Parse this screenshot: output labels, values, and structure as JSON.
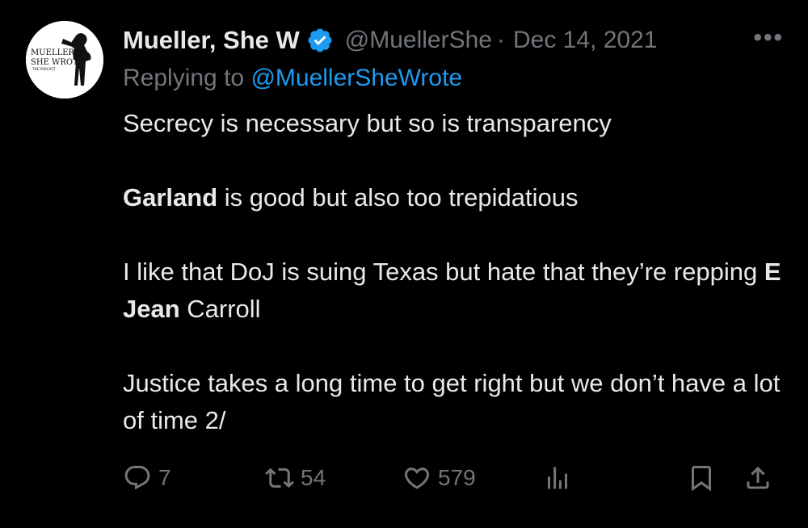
{
  "tweet": {
    "author_name": "Mueller, She W",
    "handle": "@MuellerShe",
    "separator": "·",
    "date": "Dec 14, 2021",
    "more": "•••",
    "replying_prefix": "Replying to ",
    "replying_to": "@MuellerSheWrote",
    "avatar_text": [
      "MUELLER,",
      "SHE WROTE",
      "THE PODCAST"
    ],
    "body": {
      "line1": "Secrecy is necessary but so is transparency",
      "p2_bold": "Garland",
      "p2_rest": " is good but also too trepidatious",
      "p3_a": "I like that DoJ is suing Texas but hate that they’re repping ",
      "p3_bold": "E Jean",
      "p3_rest": " Carroll",
      "p4": "Justice takes a long time to get right but we don’t have a lot of time 2/"
    }
  },
  "actions": {
    "replies": "7",
    "retweets": "54",
    "likes": "579"
  },
  "colors": {
    "background": "#000000",
    "text": "#e7e9ea",
    "muted": "#71767b",
    "link": "#1d9bf0",
    "verified": "#1d9bf0"
  },
  "icons": [
    "reply-icon",
    "retweet-icon",
    "like-icon",
    "views-icon",
    "bookmark-icon",
    "share-icon",
    "verified-badge-icon",
    "more-icon"
  ]
}
